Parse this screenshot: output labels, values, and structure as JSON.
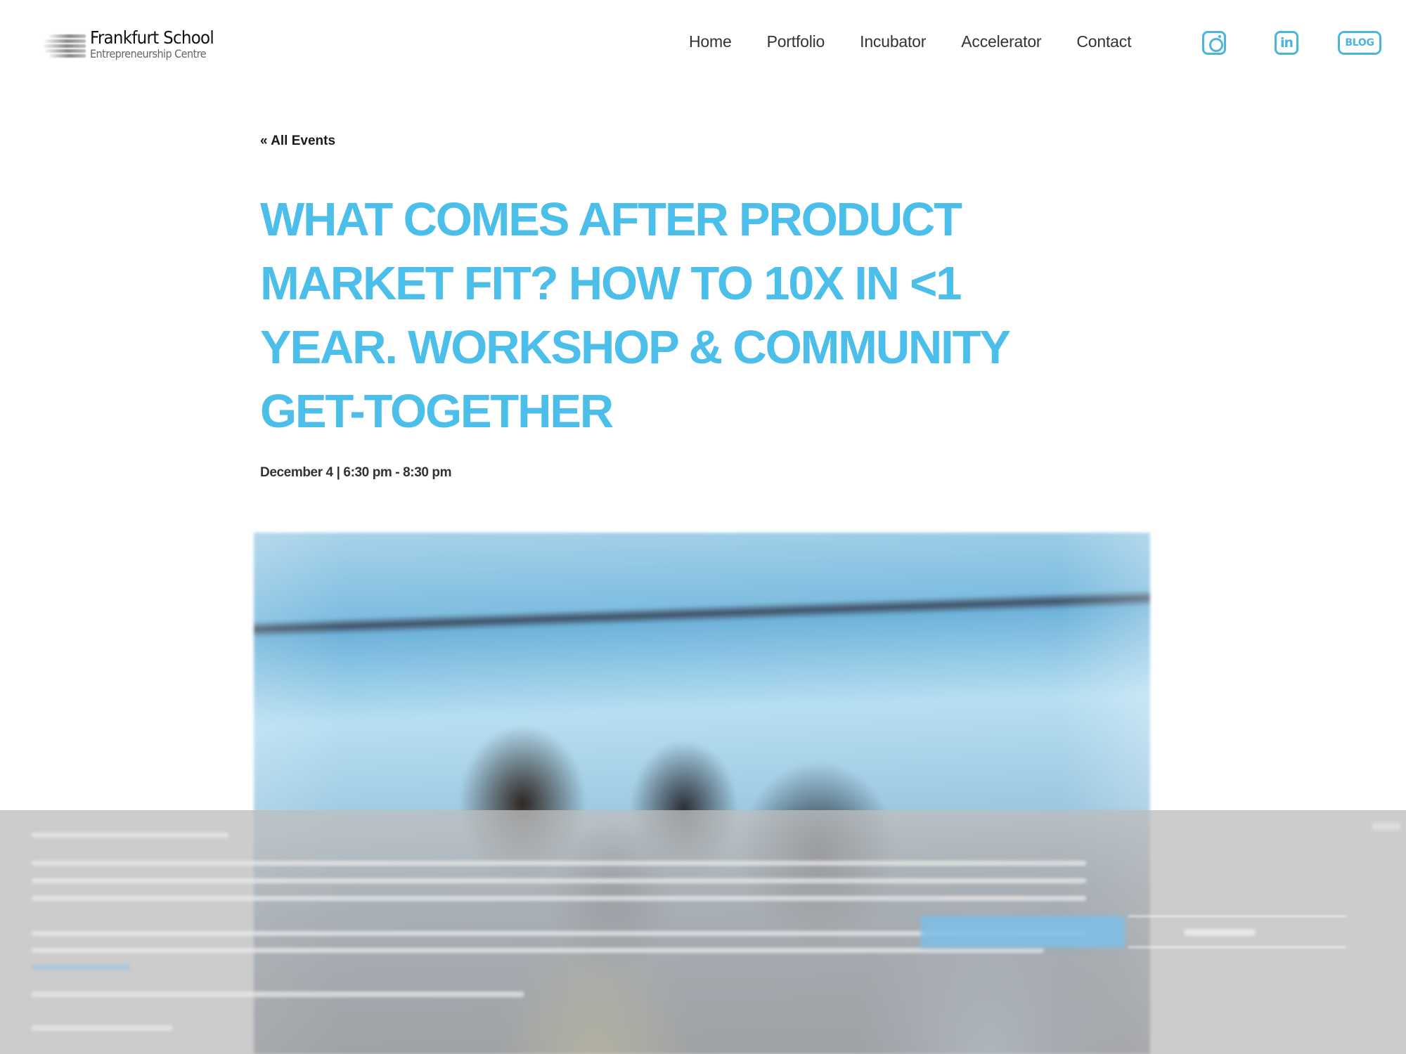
{
  "header": {
    "logo": {
      "title": "Frankfurt School",
      "subtitle": "Entrepreneurship Centre"
    },
    "nav": [
      {
        "label": "Home"
      },
      {
        "label": "Portfolio"
      },
      {
        "label": "Incubator"
      },
      {
        "label": "Accelerator"
      },
      {
        "label": "Contact"
      }
    ],
    "social": {
      "instagram_icon": "instagram-icon",
      "linkedin_label": "in",
      "blog_label": "BLOG"
    }
  },
  "event": {
    "back_link": "« All Events",
    "title": "What Comes After Product Market Fit? How to 10x in <1 Year. Workshop & Community Get-Together",
    "date": "December 4 | 6:30 pm - 8:30 pm",
    "image_alt": "People networking at a community event (blurred)"
  },
  "cookie_banner": {
    "state": "blurred overlay, text illegible",
    "buttons": [
      "accept-button",
      "settings-button"
    ]
  },
  "colors": {
    "accent": "#4bbfe9",
    "icon_blue": "#4bb5dd",
    "nav_text": "#333333",
    "banner_overlay": "#bebebe"
  }
}
